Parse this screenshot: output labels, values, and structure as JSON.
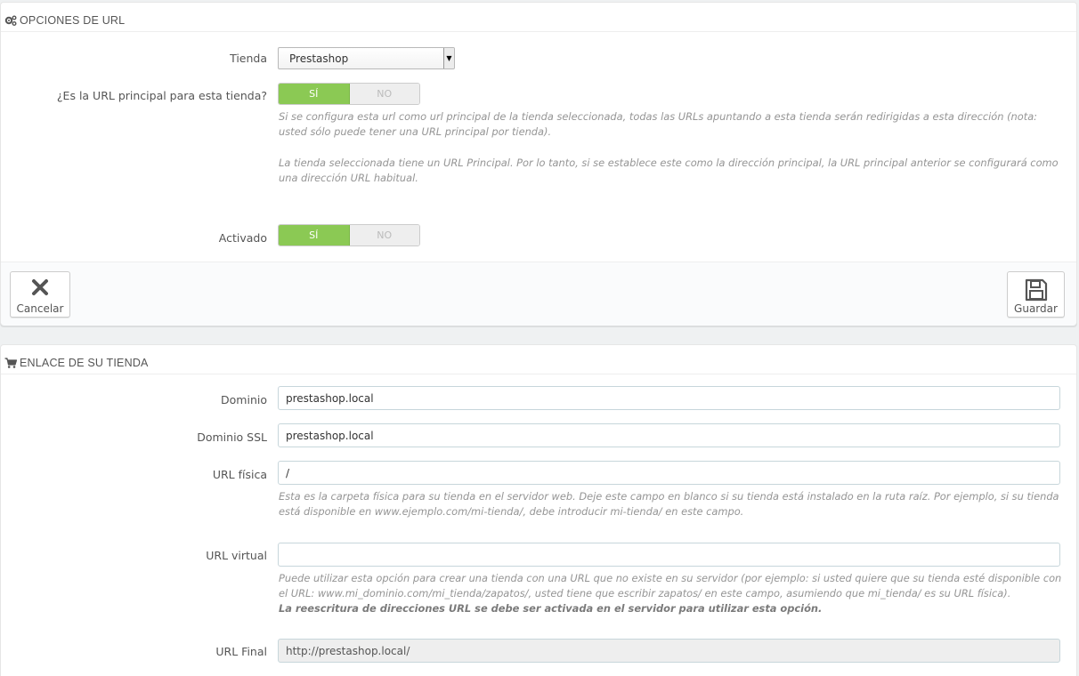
{
  "url_options": {
    "heading": "OPCIONES DE URL",
    "store_label": "Tienda",
    "store_value": "Prestashop",
    "main_url_label": "¿Es la URL principal para esta tienda?",
    "yes": "SÍ",
    "no": "NO",
    "main_url_help_1": "Si se configura esta url como url principal de la tienda seleccionada, todas las URLs apuntando a esta tienda serán redirigidas a esta dirección (nota: usted sólo puede tener una URL principal por tienda).",
    "main_url_help_2": "La tienda seleccionada tiene un URL Principal. Por lo tanto, si se establece este como la dirección principal, la URL principal anterior se configurará como una dirección URL habitual.",
    "active_label": "Activado",
    "cancel_label": "Cancelar",
    "save_label": "Guardar"
  },
  "store_link": {
    "heading": "ENLACE DE SU TIENDA",
    "domain_label": "Dominio",
    "domain_value": "prestashop.local",
    "domain_ssl_label": "Dominio SSL",
    "domain_ssl_value": "prestashop.local",
    "physical_url_label": "URL física",
    "physical_url_value": "/",
    "physical_url_help": "Esta es la carpeta física para su tienda en el servidor web. Deje este campo en blanco si su tienda está instalado en la ruta raíz. Por ejemplo, si su tienda está disponible en www.ejemplo.com/mi-tienda/, debe introducir mi-tienda/ en este campo.",
    "virtual_url_label": "URL virtual",
    "virtual_url_value": "",
    "virtual_url_help": "Puede utilizar esta opción para crear una tienda con una URL que no existe en su servidor (por ejemplo: si usted quiere que su tienda esté disponible con el URL: www.mi_dominio.com/mi_tienda/zapatos/, usted tiene que escribir zapatos/ en este campo, asumiendo que mi_tienda/ es su URL física).",
    "virtual_url_help_bold": "La reescritura de direcciones URL se debe ser activada en el servidor para utilizar esta opción.",
    "final_url_label": "URL Final",
    "final_url_value": "http://prestashop.local/"
  },
  "colors": {
    "switch_on": "#8bc954",
    "switch_off": "#eeeeee",
    "help_text": "#959595"
  }
}
